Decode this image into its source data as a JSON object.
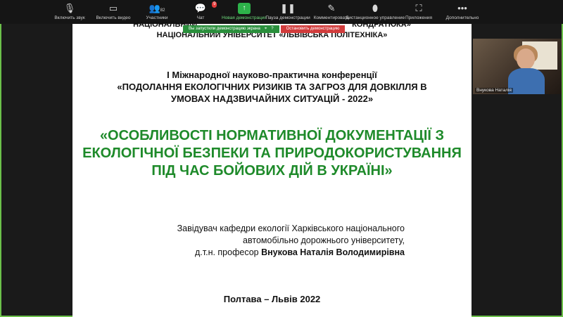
{
  "toolbar": {
    "items": [
      {
        "label": "Включить звук",
        "icon": "microphone-muted-icon"
      },
      {
        "label": "Включить видео",
        "icon": "video-off-icon"
      },
      {
        "label": "Участники",
        "icon": "participants-icon",
        "count": "82"
      },
      {
        "label": "Чат",
        "icon": "chat-icon",
        "badge": "9"
      },
      {
        "label": "Новая демонстрация",
        "icon": "share-screen-icon"
      },
      {
        "label": "Пауза демонстрации",
        "icon": "pause-icon"
      },
      {
        "label": "Комментировать",
        "icon": "annotate-icon"
      },
      {
        "label": "Дистанционное управление",
        "icon": "remote-control-icon"
      },
      {
        "label": "Приложения",
        "icon": "apps-icon"
      },
      {
        "label": "Дополнительно",
        "icon": "more-icon"
      }
    ]
  },
  "share_bar": {
    "status": "Вы запустили демонстрацию экрана",
    "stop_label": "Остановить демонстрацию"
  },
  "slide": {
    "univ_line1": "НАЦІОНАЛЬНИЙ                                                                        КОНДРАТЮКА»",
    "univ_line2": "НАЦІОНАЛЬНИЙ УНІВЕРСИТЕТ «ЛЬВІВСЬКА ПОЛІТЕХНІКА»",
    "conf_line1": "I Міжнародної науково-практична конференції",
    "conf_line2": "«ПОДОЛАННЯ ЕКОЛОГІЧНИХ РИЗИКІВ ТА ЗАГРОЗ ДЛЯ ДОВКІЛЛЯ В",
    "conf_line3": "УМОВАХ НАДЗВИЧАЙНИХ СИТУАЦІЙ - 2022»",
    "topic_line1": "«ОСОБЛИВОСТІ НОРМАТИВНОЇ ДОКУМЕНТАЦІЇ З",
    "topic_line2": "ЕКОЛОГІЧНОЇ БЕЗПЕКИ ТА ПРИРОДОКОРИСТУВАННЯ",
    "topic_line3": "ПІД ЧАС БОЙОВИХ ДІЙ В УКРАЇНІ»",
    "author_line1": "Завідувач кафедри екології Харківського національного",
    "author_line2": "автомобільно дорожнього університету,",
    "author_line3_prefix": "д.т.н. професор",
    "author_name": "Внукова Наталія Володимирівна",
    "place_year": "Полтава – Львів 2022"
  },
  "video": {
    "participant_name": "Внукова Наталія"
  },
  "colors": {
    "accent_green": "#1e8a2a",
    "frame_green": "#6cc04a",
    "stop_red": "#d23c3c"
  }
}
